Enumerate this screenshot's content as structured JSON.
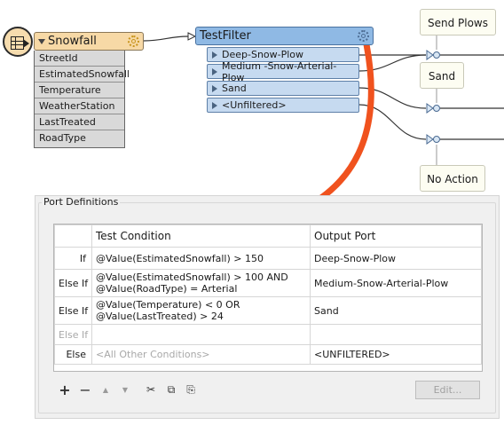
{
  "reader": {
    "name": "Snowfall",
    "attributes": [
      "StreetId",
      "EstimatedSnowfall",
      "Temperature",
      "WeatherStation",
      "LastTreated",
      "RoadType"
    ]
  },
  "testfilter": {
    "name": "TestFilter",
    "ports": [
      "Deep-Snow-Plow",
      "Medium -Snow-Arterial-Plow",
      "Sand",
      "<Unfiltered>"
    ]
  },
  "annotations": {
    "send_plows": "Send Plows",
    "sand": "Sand",
    "no_action": "No Action"
  },
  "port_definitions": {
    "title": "Port Definitions",
    "headers": {
      "condition": "Test Condition",
      "output": "Output Port"
    },
    "rows": [
      {
        "label": "If",
        "condition": "@Value(EstimatedSnowfall) > 150",
        "condition2": "",
        "output": "Deep-Snow-Plow"
      },
      {
        "label": "Else If",
        "condition": "@Value(EstimatedSnowfall) > 100 AND",
        "condition2": "@Value(RoadType) = Arterial",
        "output": "Medium-Snow-Arterial-Plow"
      },
      {
        "label": "Else If",
        "condition": "@Value(Temperature) < 0 OR",
        "condition2": "@Value(LastTreated) > 24",
        "output": "Sand"
      },
      {
        "label": "Else If",
        "condition": "",
        "condition2": "",
        "output": ""
      },
      {
        "label": "Else",
        "condition": "<All Other Conditions>",
        "condition2": "",
        "output": "<UNFILTERED>"
      }
    ],
    "toolbar": {
      "add": "+",
      "remove": "−",
      "move_up": "▲",
      "move_down": "▼",
      "cut": "✂",
      "copy": "⧉",
      "paste": "⎘",
      "edit": "Edit..."
    }
  },
  "colors": {
    "reader_fill": "#f7d9a6",
    "transformer_fill": "#8fb9e4",
    "highlight_arrow": "#f0521e"
  }
}
